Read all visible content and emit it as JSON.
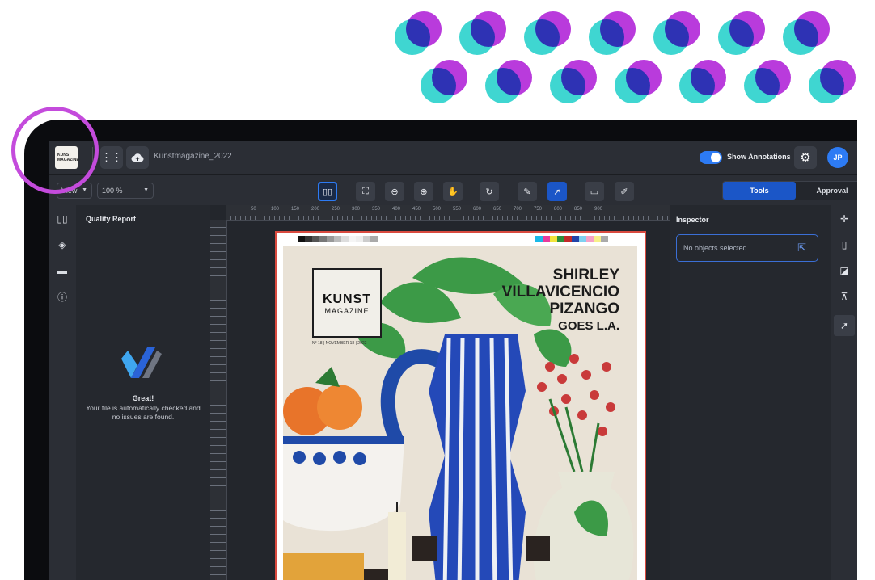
{
  "app": {
    "filename": "Kunstmagazine_2022",
    "show_annotations_label": "Show Annotations",
    "avatar_initials": "JP",
    "logo_text": "KUNST\nMAGAZINE"
  },
  "toolbar": {
    "view_label": "View",
    "zoom_label": "100 %",
    "tabs": [
      {
        "label": "Tools",
        "active": true
      },
      {
        "label": "Approval",
        "active": false
      }
    ]
  },
  "quality_report": {
    "title": "Quality Report",
    "great": "Great!",
    "message": "Your file is automatically checked and no issues are found."
  },
  "inspector": {
    "title": "Inspector",
    "empty_text": "No objects selected"
  },
  "ruler": {
    "marks": [
      "50",
      "100",
      "150",
      "200",
      "250",
      "300",
      "350",
      "400",
      "450",
      "500",
      "550",
      "600",
      "650",
      "700",
      "750",
      "800",
      "850",
      "900"
    ]
  },
  "cover": {
    "masthead_1": "KUNST",
    "masthead_2": "MAGAZINE",
    "issue_line": "N° 18 | NOVEMBER 18 | 2022",
    "headline_1": "SHIRLEY",
    "headline_2": "VILLAVICENCIO",
    "headline_3": "PIZANGO",
    "headline_4": "GOES L.A."
  },
  "colors": {
    "accent": "#2d7bf4",
    "annotation_ring": "#c44bdc",
    "dot_teal": "#3fd6d1",
    "dot_purple": "#b93bdc"
  }
}
